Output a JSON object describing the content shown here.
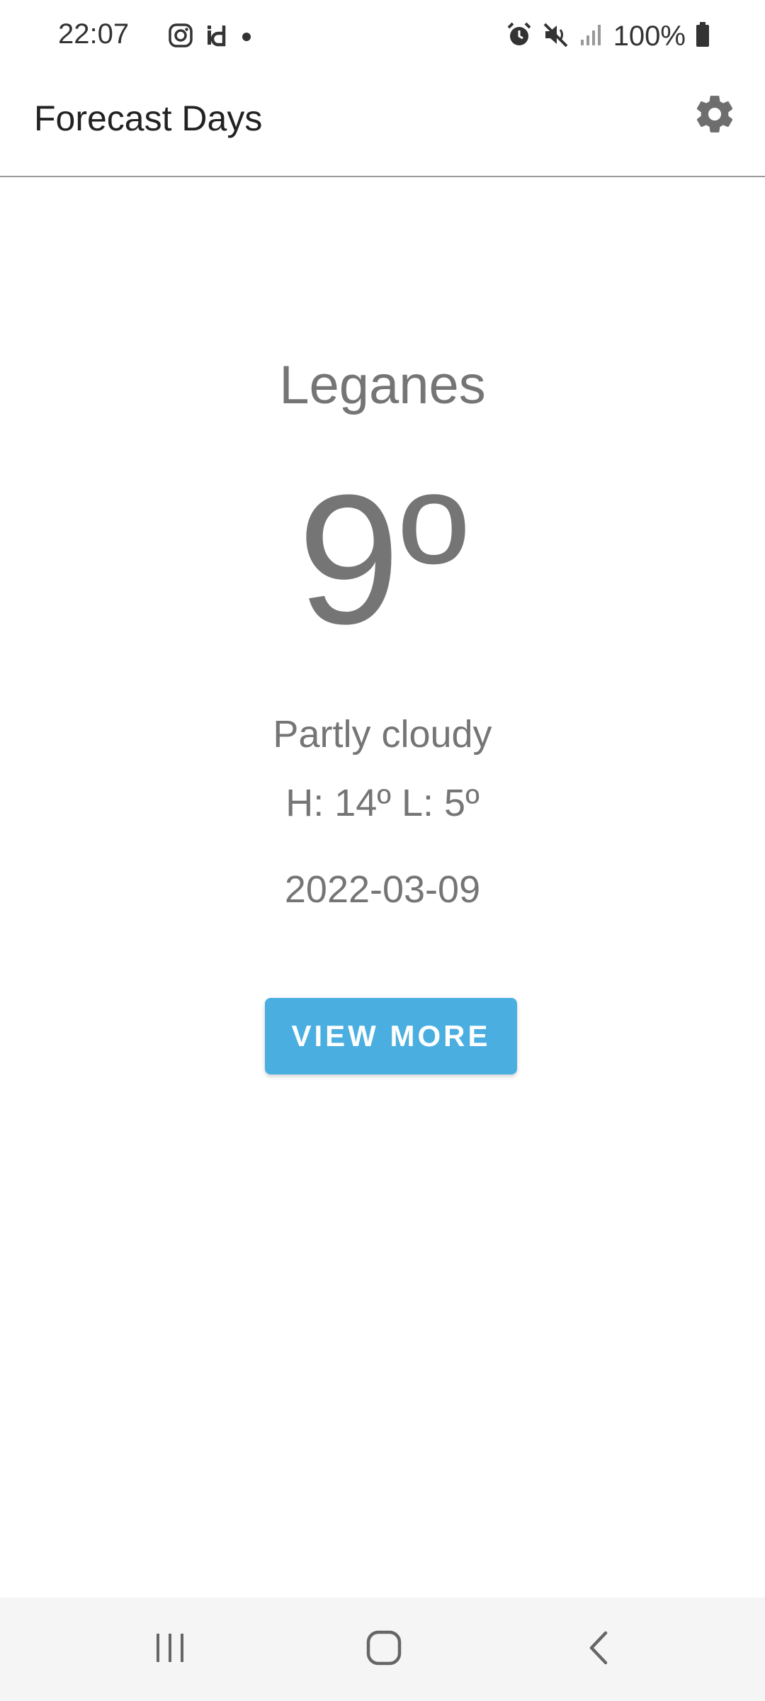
{
  "status_bar": {
    "time": "22:07",
    "battery": "100%",
    "left_icons": [
      "instagram-icon",
      "id-icon",
      "dot-icon"
    ],
    "right_icons": [
      "alarm-icon",
      "mute-icon",
      "signal-icon",
      "battery-icon"
    ]
  },
  "app_bar": {
    "title": "Forecast Days",
    "settings_icon": "gear-icon"
  },
  "weather": {
    "city": "Leganes",
    "temperature": "9º",
    "condition": "Partly cloudy",
    "high_low": "H: 14º L: 5º",
    "date": "2022-03-09"
  },
  "actions": {
    "view_more_label": "VIEW MORE"
  },
  "nav_bar": {
    "items": [
      "recent-apps-icon",
      "home-icon",
      "back-icon"
    ]
  },
  "colors": {
    "accent": "#4aafe0",
    "text_secondary": "#757575",
    "nav_background": "#f5f5f5"
  }
}
